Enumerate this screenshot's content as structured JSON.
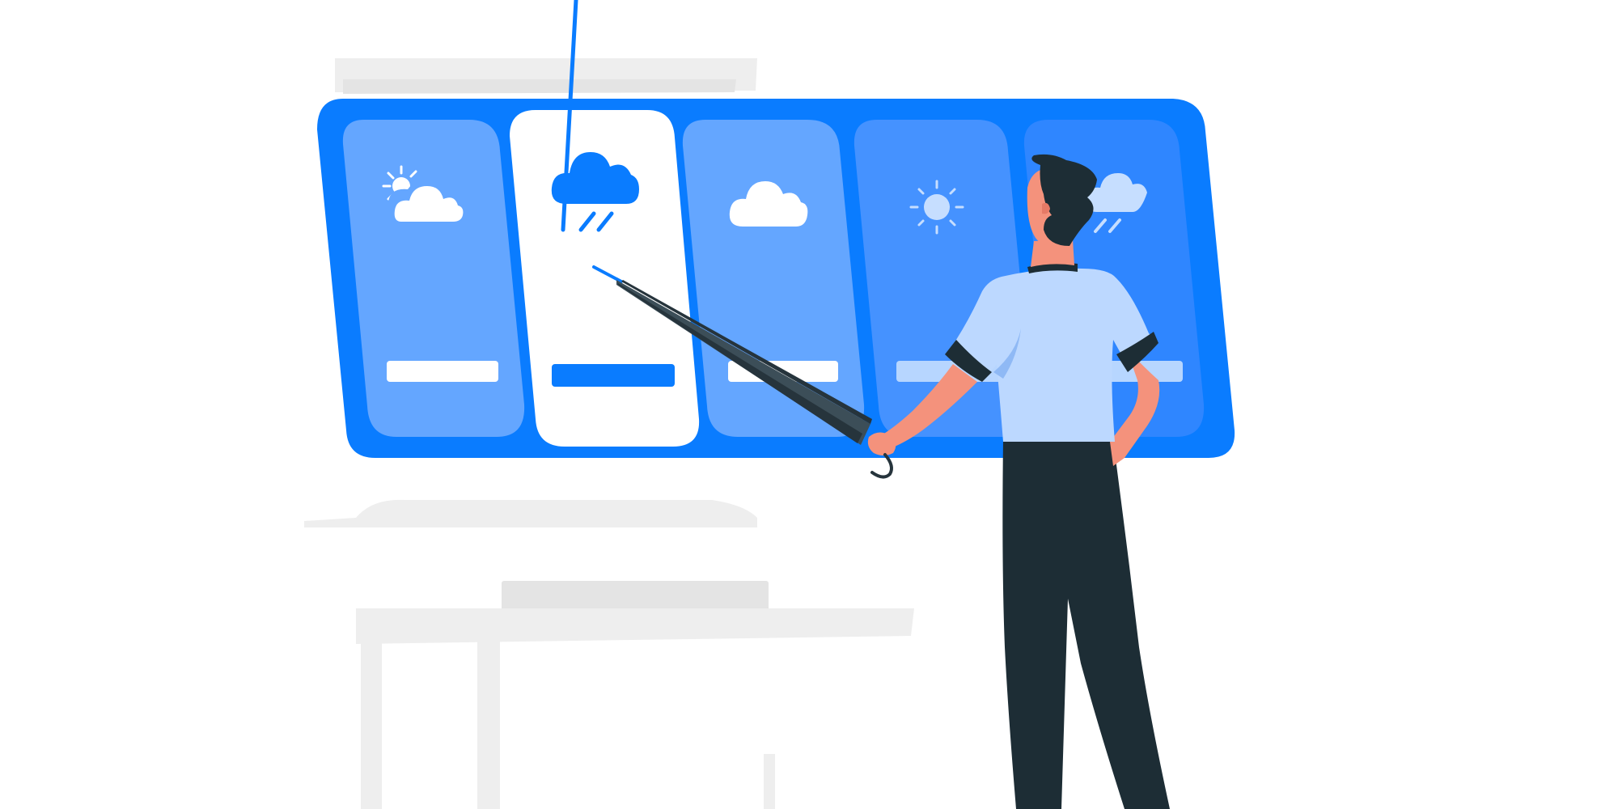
{
  "colors": {
    "background": "#ffffff",
    "panel_blue": "#0a7cff",
    "card_light": "#64a6ff",
    "card_mid": "#4592ff",
    "card_dark": "#2f86ff",
    "card_selected": "#ffffff",
    "bar_white": "#ffffff",
    "bar_selected": "#0a7cff",
    "bar_pale": "#b7d6ff",
    "icon_white": "#ffffff",
    "icon_blue": "#0a7cff",
    "icon_pale": "#c6deff",
    "ghost_gray": "#eeeeee",
    "ghost_gray_dark": "#e4e4e4",
    "skin": "#f4927c",
    "skin_dark": "#e67a66",
    "hair": "#1d2d35",
    "shirt": "#bcd8ff",
    "shirt_shade": "#8fb9f5",
    "pants": "#1d2d35",
    "cuff": "#1d2d35",
    "umbrella": "#3c4e58",
    "umbrella_dark": "#26343c",
    "umbrella_tip": "#0a7cff"
  },
  "weather_cards": [
    {
      "icon": "partly-cloudy-icon",
      "state": "default"
    },
    {
      "icon": "rain-cloud-icon",
      "state": "selected"
    },
    {
      "icon": "cloud-icon",
      "state": "default"
    },
    {
      "icon": "sun-icon",
      "state": "default"
    },
    {
      "icon": "rain-cloud-icon",
      "state": "default"
    }
  ],
  "figure": {
    "holding": "umbrella-icon"
  }
}
